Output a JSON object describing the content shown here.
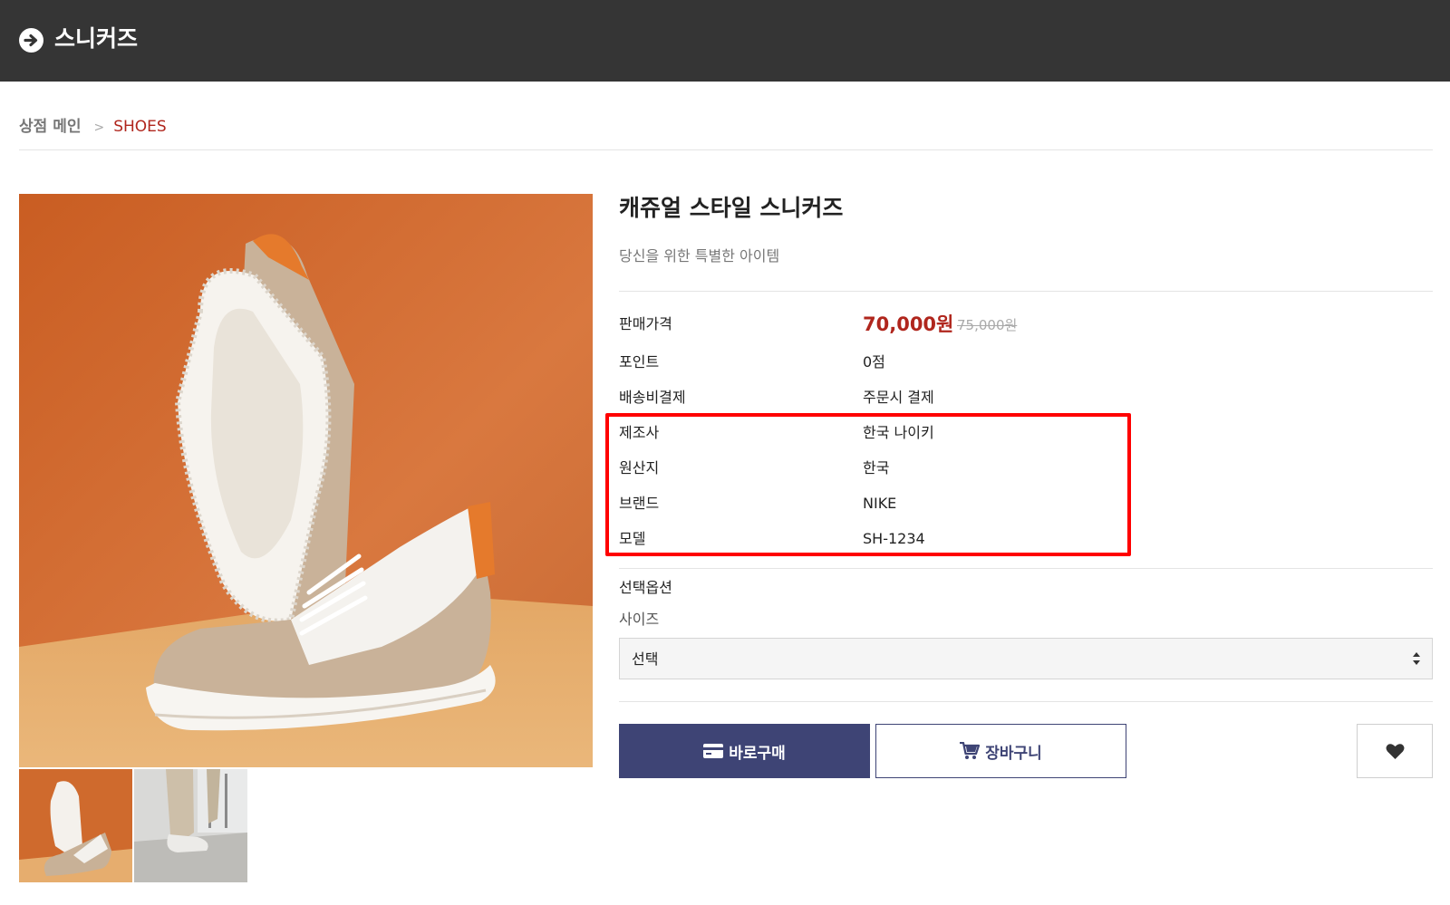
{
  "header": {
    "title": "스니커즈",
    "icon": "arrow-right-circle-icon"
  },
  "breadcrumb": {
    "home": "상점 메인",
    "separator": ">",
    "current": "SHOES"
  },
  "product": {
    "title": "캐쥬얼 스타일 스니커즈",
    "subtitle": "당신을 위한 특별한 아이템",
    "price_label": "판매가격",
    "price": "70,000원",
    "original_price": "75,000원",
    "info": [
      {
        "label": "포인트",
        "value": "0점"
      },
      {
        "label": "배송비결제",
        "value": "주문시 결제"
      },
      {
        "label": "제조사",
        "value": "한국 나이키"
      },
      {
        "label": "원산지",
        "value": "한국"
      },
      {
        "label": "브랜드",
        "value": "NIKE"
      },
      {
        "label": "모델",
        "value": "SH-1234"
      }
    ]
  },
  "options": {
    "title": "선택옵션",
    "size_label": "사이즈",
    "size_selected": "선택"
  },
  "buttons": {
    "buy": "바로구매",
    "cart": "장바구니",
    "wishlist_icon": "heart-icon"
  },
  "colors": {
    "header_bg": "#353535",
    "accent_red": "#b0261d",
    "button_navy": "#3e4475",
    "highlight_box": "#ff0000"
  }
}
